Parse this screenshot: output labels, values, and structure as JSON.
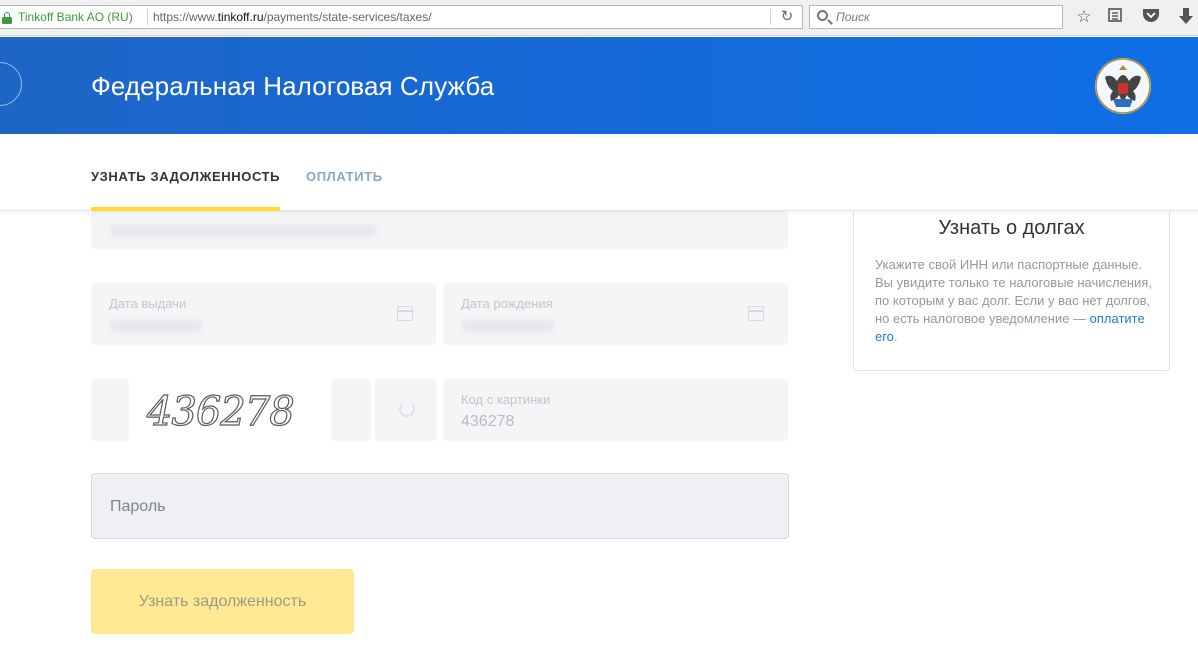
{
  "browser": {
    "identity": "Tinkoff Bank AO (RU)",
    "url_prefix": "https://www.",
    "url_domain": "tinkoff.ru",
    "url_path": "/payments/state-services/taxes/",
    "search_placeholder": "Поиск"
  },
  "header": {
    "title": "Федеральная Налоговая Служба",
    "emblem_icon": "double-headed-eagle-emblem"
  },
  "tabs": [
    {
      "label": "УЗНАТЬ ЗАДОЛЖЕННОСТЬ",
      "active": true
    },
    {
      "label": "ОПЛАТИТЬ",
      "active": false
    }
  ],
  "form": {
    "issue_date_label": "Дата выдачи",
    "birth_date_label": "Дата рождения",
    "captcha_image_text": "436278",
    "captcha_label": "Код с картинки",
    "captcha_value": "436278",
    "password_placeholder": "Пароль",
    "submit_label": "Узнать задолженность"
  },
  "info_card": {
    "title": "Узнать о долгах",
    "text_before_link": "Укажите свой ИНН или паспортные данные. Вы увидите только те налоговые начисления, по которым у вас долг. Если у вас нет долгов, но есть налоговое уведомление — ",
    "link_text": "оплатите его",
    "text_after_link": "."
  },
  "colors": {
    "header_blue": "#1669d6",
    "accent_yellow": "#ffdd2d",
    "link_blue": "#1a7fd0",
    "secure_green": "#3d9a3d"
  }
}
